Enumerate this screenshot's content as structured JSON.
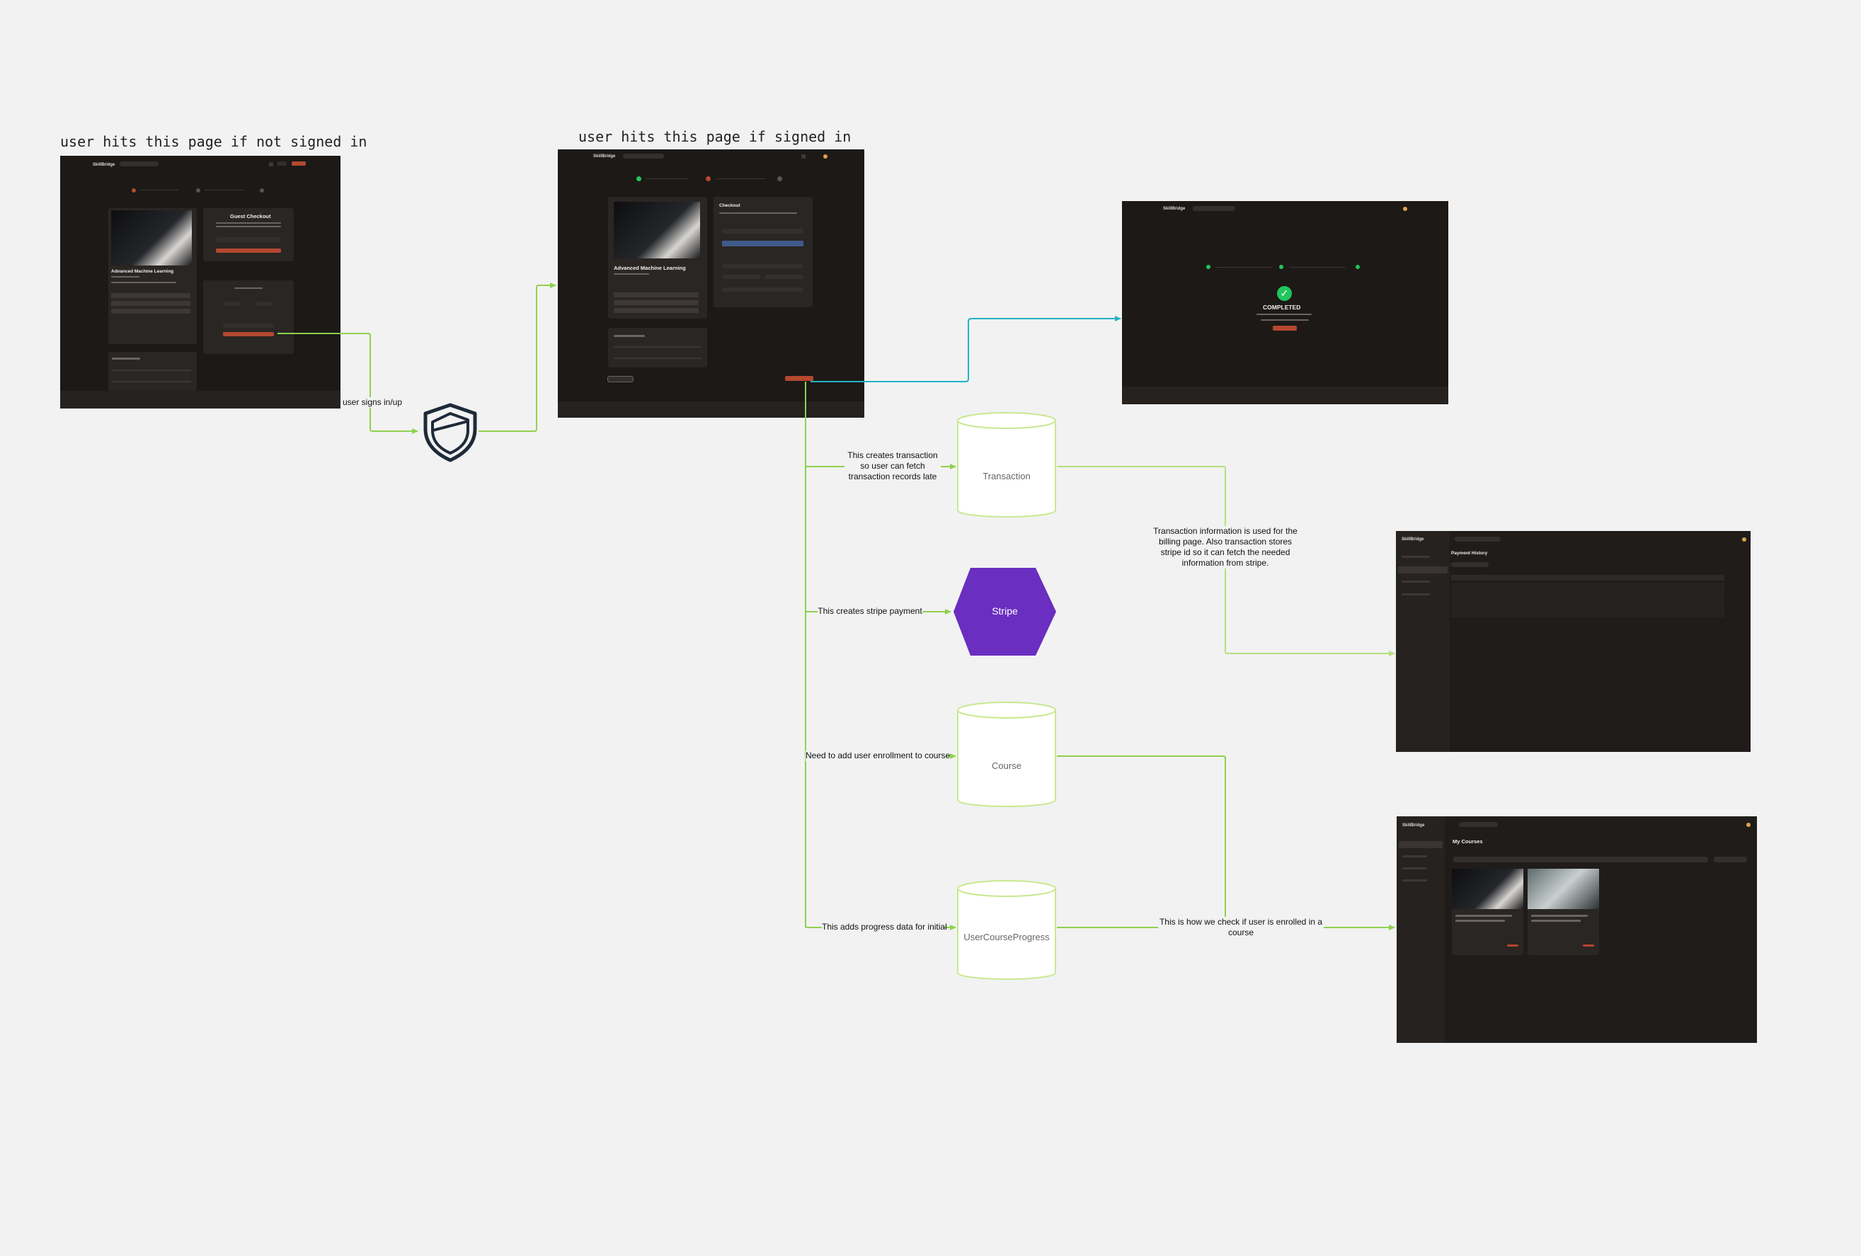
{
  "headings": {
    "not_signed_in": "user hits this page if not signed in",
    "signed_in": "user hits this page if signed in"
  },
  "screens": {
    "guest_checkout": {
      "form_title": "Guest Checkout",
      "course_title": "Advanced Machine Learning"
    },
    "checkout": {
      "form_title": "Checkout",
      "course_title": "Advanced Machine Learning"
    },
    "completed": {
      "status": "COMPLETED"
    },
    "billing": {
      "page_title": "Payment History"
    },
    "courses": {
      "page_title": "My Courses"
    }
  },
  "nodes": {
    "transaction": "Transaction",
    "stripe": "Stripe",
    "course": "Course",
    "user_course_progress": "UserCourseProgress"
  },
  "edge_labels": {
    "signs_in": "user signs in/up",
    "creates_transaction": "This creates transaction so user can fetch transaction records late",
    "creates_stripe": "This creates stripe payment",
    "add_enrollment": "Need to add user enrollment to course",
    "adds_progress": "This adds progress data for initial",
    "transaction_info": "Transaction information is used for the billing page. Also transaction stores stripe id so it can fetch the needed information from stripe.",
    "enrolled_check": "This is how we check if user is enrolled in a course"
  },
  "colors": {
    "canvas": "#f2f2f2",
    "flow_line": "#8fd14f",
    "light_line": "#b5e07f",
    "teal_line": "#21b3c3",
    "stripe": "#6a2ec0",
    "screen_bg": "#1c1917",
    "accent_orange": "#b4482f",
    "success_green": "#22c55e"
  },
  "icons": {
    "auth": "shield-icon",
    "check": "check-circle-icon"
  }
}
